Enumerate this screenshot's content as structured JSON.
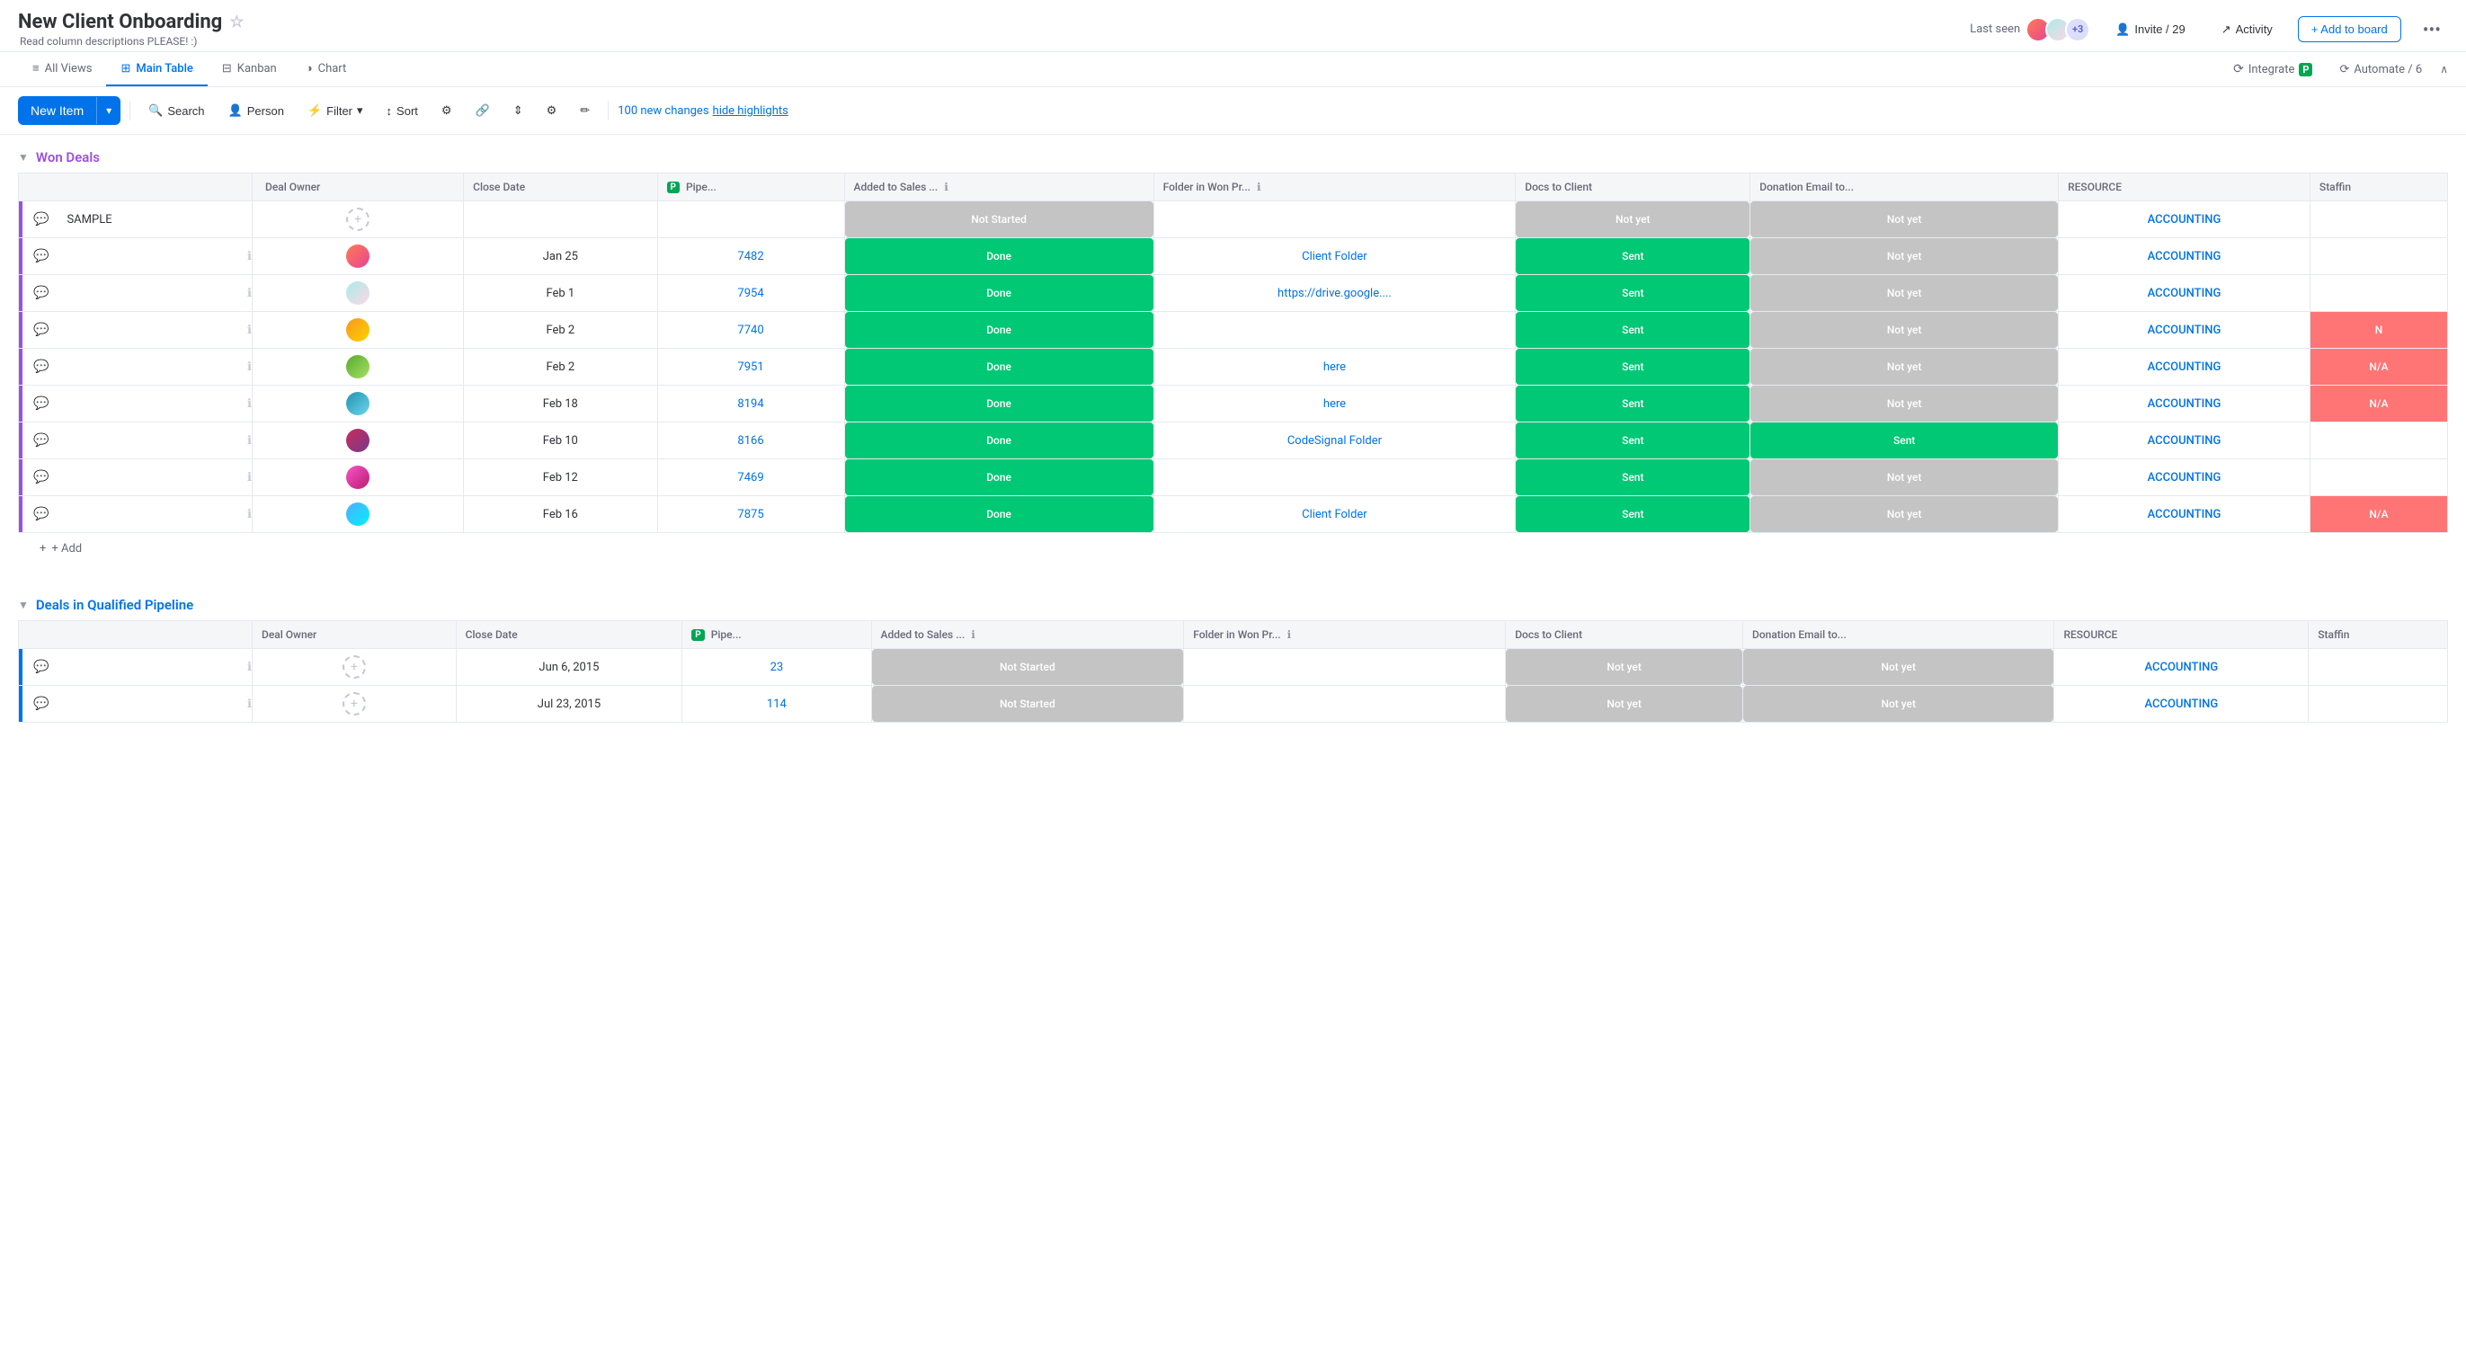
{
  "header": {
    "title": "New Client Onboarding",
    "subtitle": "Read column descriptions PLEASE! :)",
    "last_seen_label": "Last seen",
    "avatar_count": "+3",
    "invite_label": "Invite / 29",
    "activity_label": "Activity",
    "add_to_board_label": "+ Add to board",
    "more_icon": "•••"
  },
  "tabs": {
    "items": [
      {
        "label": "All Views",
        "icon": "≡",
        "active": false
      },
      {
        "label": "Main Table",
        "icon": "⊞",
        "active": true
      },
      {
        "label": "Kanban",
        "icon": "⊟",
        "active": false
      },
      {
        "label": "Chart",
        "icon": "◑",
        "active": false
      }
    ],
    "integrate_label": "Integrate",
    "automate_label": "Automate / 6"
  },
  "toolbar": {
    "new_item_label": "New Item",
    "search_label": "Search",
    "person_label": "Person",
    "filter_label": "Filter",
    "sort_label": "Sort",
    "highlight_changes": "100 new changes",
    "hide_highlights": "hide highlights"
  },
  "columns": [
    {
      "key": "name",
      "label": "",
      "width": "260"
    },
    {
      "key": "deal_owner",
      "label": "Deal Owner"
    },
    {
      "key": "close_date",
      "label": "Close Date"
    },
    {
      "key": "pipeline",
      "label": "Pipe..."
    },
    {
      "key": "added_to_sales",
      "label": "Added to Sales ..."
    },
    {
      "key": "folder_in_won",
      "label": "Folder in Won Pr..."
    },
    {
      "key": "docs_to_client",
      "label": "Docs to Client"
    },
    {
      "key": "donation_email",
      "label": "Donation Email to..."
    },
    {
      "key": "resource",
      "label": "RESOURCE"
    },
    {
      "key": "staffing",
      "label": "Staffin"
    }
  ],
  "groups": [
    {
      "id": "won_deals",
      "title": "Won Deals",
      "color": "won",
      "rows": [
        {
          "name": "SAMPLE",
          "deal_owner": null,
          "close_date": "",
          "pipeline": "",
          "added_to_sales": "Not Started",
          "added_status": "not-started",
          "folder_in_won": "",
          "docs_to_client": "Not yet",
          "docs_status": "not-yet",
          "donation_email": "Not yet",
          "donation_status": "not-yet",
          "resource": "ACCOUNTING",
          "staffing": "",
          "staffing_type": "normal",
          "avatar_class": ""
        },
        {
          "name": "",
          "deal_owner": "av1",
          "close_date": "Jan 25",
          "pipeline": "7482",
          "added_to_sales": "Done",
          "added_status": "done",
          "folder_in_won": "Client Folder",
          "docs_to_client": "Sent",
          "docs_status": "sent",
          "donation_email": "Not yet",
          "donation_status": "not-yet",
          "resource": "ACCOUNTING",
          "staffing": "",
          "staffing_type": "green"
        },
        {
          "name": "",
          "deal_owner": "av2",
          "close_date": "Feb 1",
          "pipeline": "7954",
          "added_to_sales": "Done",
          "added_status": "done",
          "folder_in_won": "https://drive.google....",
          "docs_to_client": "Sent",
          "docs_status": "sent",
          "donation_email": "Not yet",
          "donation_status": "not-yet",
          "resource": "ACCOUNTING",
          "staffing": "",
          "staffing_type": "green"
        },
        {
          "name": "",
          "deal_owner": "av3",
          "close_date": "Feb 2",
          "pipeline": "7740",
          "added_to_sales": "Done",
          "added_status": "done",
          "folder_in_won": "",
          "docs_to_client": "Sent",
          "docs_status": "sent",
          "donation_email": "Not yet",
          "donation_status": "not-yet",
          "resource": "ACCOUNTING",
          "staffing": "N",
          "staffing_type": "na"
        },
        {
          "name": "",
          "deal_owner": "av4",
          "close_date": "Feb 2",
          "pipeline": "7951",
          "added_to_sales": "Done",
          "added_status": "done",
          "folder_in_won": "here",
          "docs_to_client": "Sent",
          "docs_status": "sent",
          "donation_email": "Not yet",
          "donation_status": "not-yet",
          "resource": "ACCOUNTING",
          "staffing": "N/A",
          "staffing_type": "na"
        },
        {
          "name": "",
          "deal_owner": "av5",
          "close_date": "Feb 18",
          "pipeline": "8194",
          "added_to_sales": "Done",
          "added_status": "done",
          "folder_in_won": "here",
          "docs_to_client": "Sent",
          "docs_status": "sent",
          "donation_email": "Not yet",
          "donation_status": "not-yet",
          "resource": "ACCOUNTING",
          "staffing": "N/A",
          "staffing_type": "na"
        },
        {
          "name": "",
          "deal_owner": "av6",
          "close_date": "Feb 10",
          "pipeline": "8166",
          "added_to_sales": "Done",
          "added_status": "done",
          "folder_in_won": "CodeSignal Folder",
          "docs_to_client": "Sent",
          "docs_status": "sent",
          "donation_email": "Sent",
          "donation_status": "sent",
          "resource": "ACCOUNTING",
          "staffing": "",
          "staffing_type": "green"
        },
        {
          "name": "",
          "deal_owner": "av7",
          "close_date": "Feb 12",
          "pipeline": "7469",
          "added_to_sales": "Done",
          "added_status": "done",
          "folder_in_won": "",
          "docs_to_client": "Sent",
          "docs_status": "sent",
          "donation_email": "Not yet",
          "donation_status": "not-yet",
          "resource": "ACCOUNTING",
          "staffing": "",
          "staffing_type": "green"
        },
        {
          "name": "",
          "deal_owner": "av8",
          "close_date": "Feb 16",
          "pipeline": "7875",
          "added_to_sales": "Done",
          "added_status": "done",
          "folder_in_won": "Client Folder",
          "docs_to_client": "Sent",
          "docs_status": "sent",
          "donation_email": "Not yet",
          "donation_status": "not-yet",
          "resource": "ACCOUNTING",
          "staffing": "N/A",
          "staffing_type": "na"
        }
      ]
    },
    {
      "id": "pipeline_deals",
      "title": "Deals in Qualified Pipeline",
      "color": "pipeline",
      "rows": [
        {
          "name": "",
          "deal_owner": null,
          "close_date": "Jun 6, 2015",
          "pipeline": "23",
          "added_to_sales": "Not Started",
          "added_status": "not-started",
          "folder_in_won": "",
          "docs_to_client": "Not yet",
          "docs_status": "not-yet",
          "donation_email": "Not yet",
          "donation_status": "not-yet",
          "resource": "ACCOUNTING",
          "staffing": "",
          "staffing_type": "normal"
        },
        {
          "name": "",
          "deal_owner": null,
          "close_date": "Jul 23, 2015",
          "pipeline": "114",
          "added_to_sales": "Not Started",
          "added_status": "not-started",
          "folder_in_won": "",
          "docs_to_client": "Not yet",
          "docs_status": "not-yet",
          "donation_email": "Not yet",
          "donation_status": "not-yet",
          "resource": "ACCOUNTING",
          "staffing": "",
          "staffing_type": "normal"
        }
      ]
    }
  ]
}
